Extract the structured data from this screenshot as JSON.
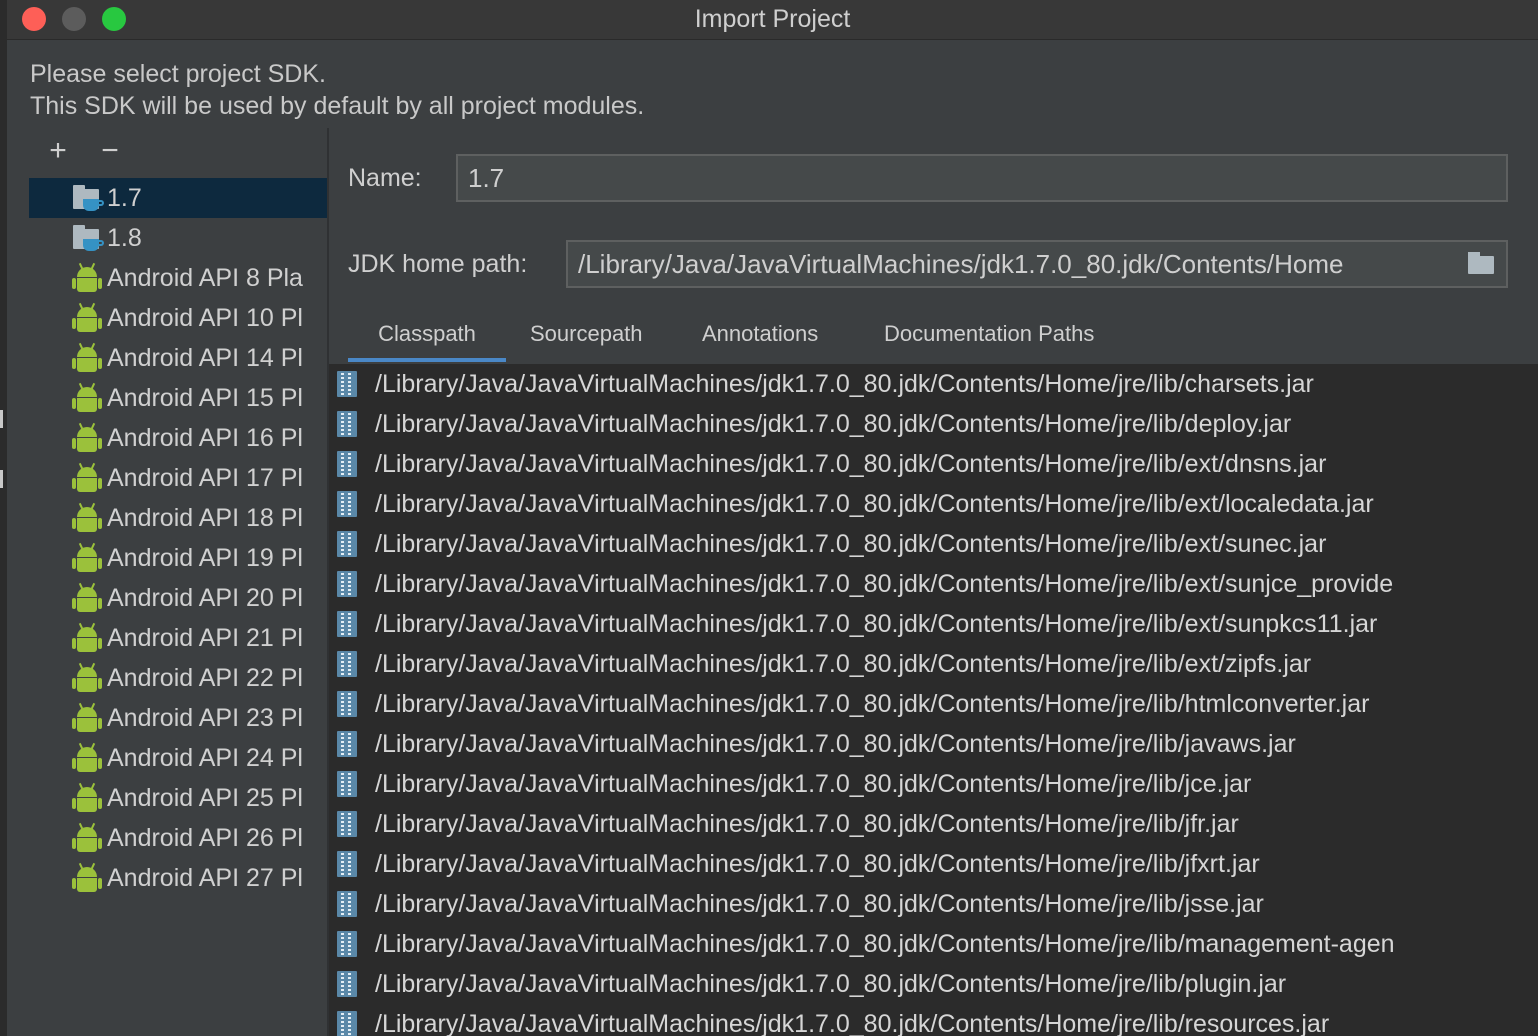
{
  "window": {
    "title": "Import Project"
  },
  "intro": {
    "line1": "Please select project SDK.",
    "line2": "This SDK will be used by default by all project modules."
  },
  "toolbar": {
    "add_label": "+",
    "remove_label": "−"
  },
  "sdk_list": {
    "items": [
      {
        "label": "1.7",
        "type": "jdk",
        "selected": true
      },
      {
        "label": "1.8",
        "type": "jdk",
        "selected": false
      },
      {
        "label": "Android API 8 Pla",
        "type": "android"
      },
      {
        "label": "Android API 10 Pl",
        "type": "android"
      },
      {
        "label": "Android API 14 Pl",
        "type": "android"
      },
      {
        "label": "Android API 15 Pl",
        "type": "android"
      },
      {
        "label": "Android API 16 Pl",
        "type": "android"
      },
      {
        "label": "Android API 17 Pl",
        "type": "android"
      },
      {
        "label": "Android API 18 Pl",
        "type": "android"
      },
      {
        "label": "Android API 19 Pl",
        "type": "android"
      },
      {
        "label": "Android API 20 Pl",
        "type": "android"
      },
      {
        "label": "Android API 21 Pl",
        "type": "android"
      },
      {
        "label": "Android API 22 Pl",
        "type": "android"
      },
      {
        "label": "Android API 23 Pl",
        "type": "android"
      },
      {
        "label": "Android API 24 Pl",
        "type": "android"
      },
      {
        "label": "Android API 25 Pl",
        "type": "android"
      },
      {
        "label": "Android API 26 Pl",
        "type": "android"
      },
      {
        "label": "Android API 27 Pl",
        "type": "android"
      }
    ]
  },
  "form": {
    "name_label": "Name:",
    "name_value": "1.7",
    "home_label": "JDK home path:",
    "home_value": "/Library/Java/JavaVirtualMachines/jdk1.7.0_80.jdk/Contents/Home"
  },
  "tabs": [
    {
      "label": "Classpath",
      "active": true
    },
    {
      "label": "Sourcepath",
      "active": false
    },
    {
      "label": "Annotations",
      "active": false
    },
    {
      "label": "Documentation Paths",
      "active": false
    }
  ],
  "classpath": [
    "/Library/Java/JavaVirtualMachines/jdk1.7.0_80.jdk/Contents/Home/jre/lib/charsets.jar",
    "/Library/Java/JavaVirtualMachines/jdk1.7.0_80.jdk/Contents/Home/jre/lib/deploy.jar",
    "/Library/Java/JavaVirtualMachines/jdk1.7.0_80.jdk/Contents/Home/jre/lib/ext/dnsns.jar",
    "/Library/Java/JavaVirtualMachines/jdk1.7.0_80.jdk/Contents/Home/jre/lib/ext/localedata.jar",
    "/Library/Java/JavaVirtualMachines/jdk1.7.0_80.jdk/Contents/Home/jre/lib/ext/sunec.jar",
    "/Library/Java/JavaVirtualMachines/jdk1.7.0_80.jdk/Contents/Home/jre/lib/ext/sunjce_provide",
    "/Library/Java/JavaVirtualMachines/jdk1.7.0_80.jdk/Contents/Home/jre/lib/ext/sunpkcs11.jar",
    "/Library/Java/JavaVirtualMachines/jdk1.7.0_80.jdk/Contents/Home/jre/lib/ext/zipfs.jar",
    "/Library/Java/JavaVirtualMachines/jdk1.7.0_80.jdk/Contents/Home/jre/lib/htmlconverter.jar",
    "/Library/Java/JavaVirtualMachines/jdk1.7.0_80.jdk/Contents/Home/jre/lib/javaws.jar",
    "/Library/Java/JavaVirtualMachines/jdk1.7.0_80.jdk/Contents/Home/jre/lib/jce.jar",
    "/Library/Java/JavaVirtualMachines/jdk1.7.0_80.jdk/Contents/Home/jre/lib/jfr.jar",
    "/Library/Java/JavaVirtualMachines/jdk1.7.0_80.jdk/Contents/Home/jre/lib/jfxrt.jar",
    "/Library/Java/JavaVirtualMachines/jdk1.7.0_80.jdk/Contents/Home/jre/lib/jsse.jar",
    "/Library/Java/JavaVirtualMachines/jdk1.7.0_80.jdk/Contents/Home/jre/lib/management-agen",
    "/Library/Java/JavaVirtualMachines/jdk1.7.0_80.jdk/Contents/Home/jre/lib/plugin.jar",
    "/Library/Java/JavaVirtualMachines/jdk1.7.0_80.jdk/Contents/Home/jre/lib/resources.jar"
  ]
}
